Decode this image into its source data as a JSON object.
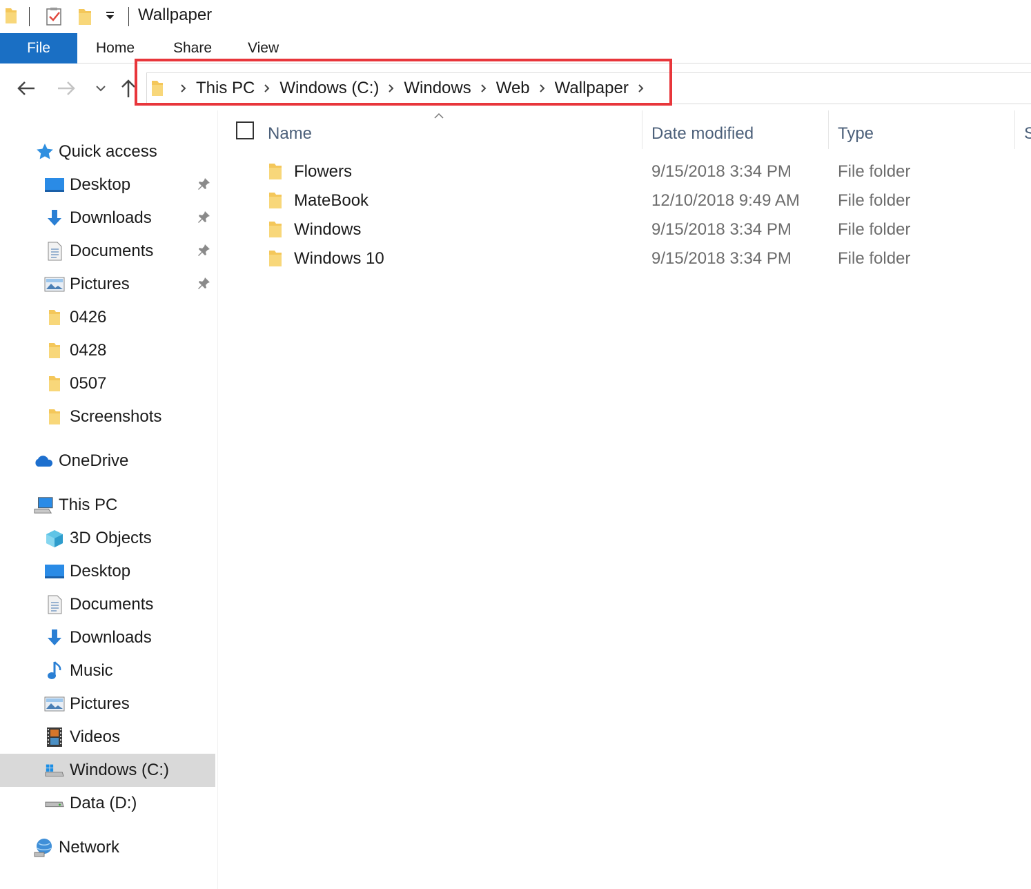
{
  "window": {
    "title": "Wallpaper"
  },
  "ribbon": {
    "tabs": [
      {
        "label": "File",
        "active": true
      },
      {
        "label": "Home"
      },
      {
        "label": "Share"
      },
      {
        "label": "View"
      }
    ]
  },
  "address": {
    "breadcrumbs": [
      "This PC",
      "Windows (C:)",
      "Windows",
      "Web",
      "Wallpaper"
    ]
  },
  "sidebar": {
    "quick_access": {
      "label": "Quick access",
      "items": [
        {
          "label": "Desktop",
          "icon": "desktop-icon",
          "pinned": true
        },
        {
          "label": "Downloads",
          "icon": "downloads-icon",
          "pinned": true
        },
        {
          "label": "Documents",
          "icon": "documents-icon",
          "pinned": true
        },
        {
          "label": "Pictures",
          "icon": "pictures-icon",
          "pinned": true
        },
        {
          "label": "0426",
          "icon": "folder-icon"
        },
        {
          "label": "0428",
          "icon": "folder-icon"
        },
        {
          "label": "0507",
          "icon": "folder-icon"
        },
        {
          "label": "Screenshots",
          "icon": "folder-icon"
        }
      ]
    },
    "onedrive": {
      "label": "OneDrive"
    },
    "this_pc": {
      "label": "This PC",
      "items": [
        {
          "label": "3D Objects",
          "icon": "3d-objects-icon"
        },
        {
          "label": "Desktop",
          "icon": "desktop-icon"
        },
        {
          "label": "Documents",
          "icon": "documents-icon"
        },
        {
          "label": "Downloads",
          "icon": "downloads-icon"
        },
        {
          "label": "Music",
          "icon": "music-icon"
        },
        {
          "label": "Pictures",
          "icon": "pictures-icon"
        },
        {
          "label": "Videos",
          "icon": "videos-icon"
        },
        {
          "label": "Windows (C:)",
          "icon": "windows-drive-icon",
          "selected": true
        },
        {
          "label": "Data (D:)",
          "icon": "drive-icon"
        }
      ]
    },
    "network": {
      "label": "Network"
    }
  },
  "file_list": {
    "columns": {
      "name": "Name",
      "date": "Date modified",
      "type": "Type",
      "size": "S"
    },
    "rows": [
      {
        "name": "Flowers",
        "date": "9/15/2018 3:34 PM",
        "type": "File folder"
      },
      {
        "name": "MateBook",
        "date": "12/10/2018 9:49 AM",
        "type": "File folder"
      },
      {
        "name": "Windows",
        "date": "9/15/2018 3:34 PM",
        "type": "File folder"
      },
      {
        "name": "Windows 10",
        "date": "9/15/2018 3:34 PM",
        "type": "File folder"
      }
    ]
  },
  "colors": {
    "file_tab": "#1a6fc4",
    "folder": "#f4c75a",
    "highlight": "#e8363b",
    "selected_row": "#d9d9d9",
    "header_text": "#4c607a"
  }
}
